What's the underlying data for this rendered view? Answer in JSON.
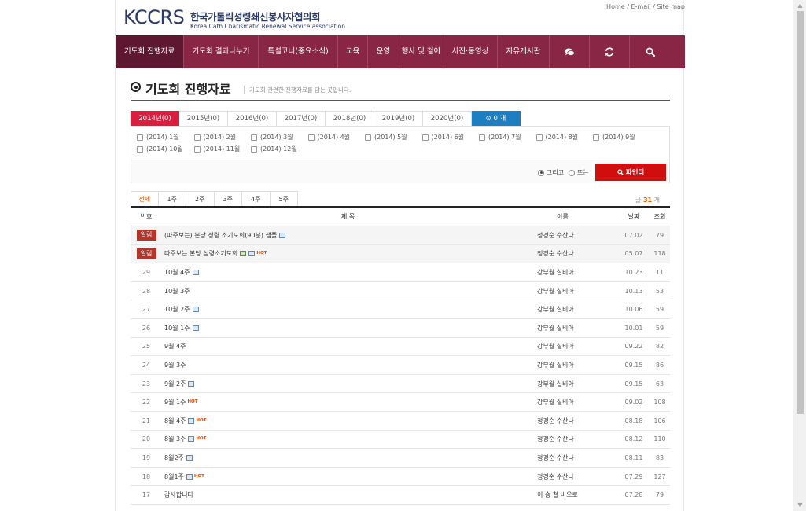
{
  "header": {
    "logo": "KCCRS",
    "org_name_kr": "한국가톨릭성령쇄신봉사자협의회",
    "org_name_en": "Korea Cath.Charismatic Renewal Service association",
    "top_links": "Home / E-mail / Site map"
  },
  "nav": {
    "items": [
      {
        "label": "기도회 진행자료",
        "active": true
      },
      {
        "label": "기도회 결과나누기"
      },
      {
        "label": "특설코너(중요소식)"
      },
      {
        "label": "교육"
      },
      {
        "label": "운영"
      },
      {
        "label": "행사 및 철야"
      },
      {
        "label": "사진·동영상"
      },
      {
        "label": "자유게시판"
      }
    ],
    "icons": [
      "chat-icon",
      "refresh-icon",
      "search-icon"
    ]
  },
  "page": {
    "title": "기도회 진행자료",
    "description": "기도회 관련한 진행자료를 담는 곳입니다."
  },
  "year_tabs": [
    "2014년(0)",
    "2015년(0)",
    "2016년(0)",
    "2017년(0)",
    "2018년(0)",
    "2019년(0)",
    "2020년(0)"
  ],
  "selected_count": "0 개",
  "months": [
    "(2014) 1월",
    "(2014) 2월",
    "(2014) 3월",
    "(2014) 4월",
    "(2014) 5월",
    "(2014) 6월",
    "(2014) 7월",
    "(2014) 8월",
    "(2014) 9월",
    "(2014) 10월",
    "(2014) 11월",
    "(2014) 12월"
  ],
  "filter": {
    "and_label": "그리고",
    "or_label": "또는",
    "button": "파인더"
  },
  "week_tabs": [
    "전체",
    "1주",
    "2주",
    "3주",
    "4주",
    "5주"
  ],
  "total": {
    "prefix": "글",
    "count": "31",
    "suffix": "개"
  },
  "table": {
    "headers": {
      "num": "번호",
      "title": "제 목",
      "name": "이름",
      "date": "날짜",
      "views": "조회"
    },
    "rows": [
      {
        "num": "알림",
        "notice": true,
        "title": "(따주보는) 본당 성령 소기도회(90분) 샘플",
        "file": true,
        "name": "정경순 수산나",
        "date": "07.02",
        "views": "79"
      },
      {
        "num": "알림",
        "notice": true,
        "title": "따주보는 본당 성령소기도회",
        "img": true,
        "file": true,
        "hot": true,
        "name": "정경순 수산나",
        "date": "05.07",
        "views": "118"
      },
      {
        "num": "29",
        "title": "10월 4주",
        "file": true,
        "name": "강부월 실비아",
        "date": "10.23",
        "views": "11"
      },
      {
        "num": "28",
        "title": "10월 3주",
        "name": "강부월 실비아",
        "date": "10.13",
        "views": "53"
      },
      {
        "num": "27",
        "title": "10월 2주",
        "file": true,
        "name": "강부월 실비아",
        "date": "10.06",
        "views": "59"
      },
      {
        "num": "26",
        "title": "10월 1주",
        "file": true,
        "name": "강부월 실비아",
        "date": "10.01",
        "views": "59"
      },
      {
        "num": "25",
        "title": "9월 4주",
        "name": "강부월 실비아",
        "date": "09.22",
        "views": "82"
      },
      {
        "num": "24",
        "title": "9월 3주",
        "name": "강부월 실비아",
        "date": "09.15",
        "views": "86"
      },
      {
        "num": "23",
        "title": "9월 2주",
        "file": true,
        "name": "강부월 실비아",
        "date": "09.15",
        "views": "63"
      },
      {
        "num": "22",
        "title": "9월 1주",
        "hot": true,
        "name": "강부월 실비아",
        "date": "09.02",
        "views": "108"
      },
      {
        "num": "21",
        "title": "8월 4주",
        "file": true,
        "hot": true,
        "name": "정경순 수산나",
        "date": "08.18",
        "views": "106"
      },
      {
        "num": "20",
        "title": "8월 3주",
        "file": true,
        "hot": true,
        "name": "정경순 수산나",
        "date": "08.12",
        "views": "110"
      },
      {
        "num": "19",
        "title": "8월2주",
        "file": true,
        "name": "정경순 수산나",
        "date": "08.11",
        "views": "83"
      },
      {
        "num": "18",
        "title": "8월1주",
        "file": true,
        "hot": true,
        "name": "정경순 수산나",
        "date": "07.29",
        "views": "127"
      },
      {
        "num": "17",
        "title": "감사합니다",
        "name": "이 승 철 바오로",
        "date": "07.28",
        "views": "79"
      }
    ]
  }
}
